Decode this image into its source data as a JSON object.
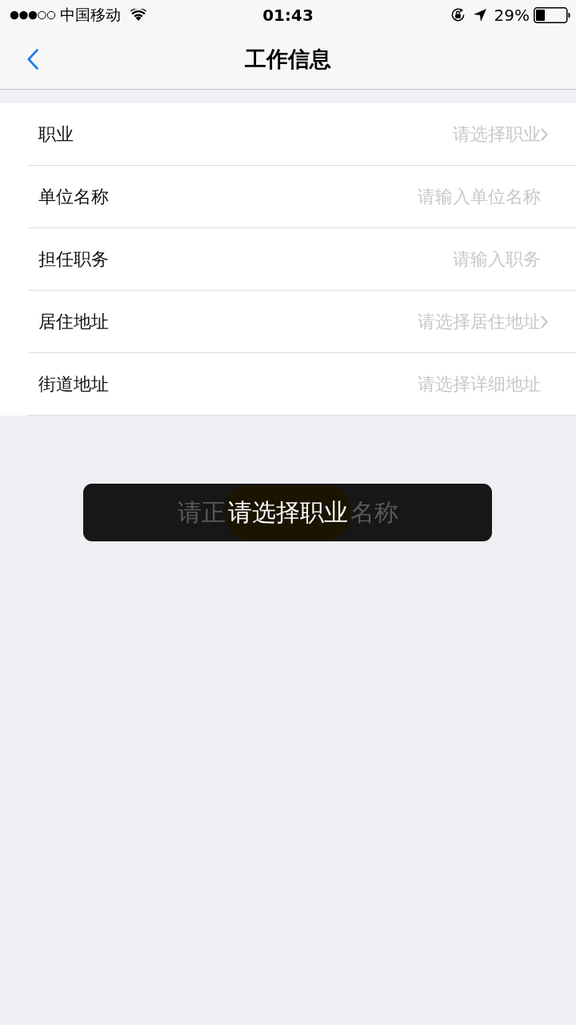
{
  "status_bar": {
    "carrier": "中国移动",
    "time": "01:43",
    "battery": "29%"
  },
  "nav": {
    "title": "工作信息"
  },
  "rows": [
    {
      "label": "职业",
      "placeholder": "请选择职业",
      "kind": "select"
    },
    {
      "label": "单位名称",
      "placeholder": "请输入单位名称",
      "kind": "input"
    },
    {
      "label": "担任职务",
      "placeholder": "请输入职务",
      "kind": "input"
    },
    {
      "label": "居住地址",
      "placeholder": "请选择居住地址",
      "kind": "select"
    },
    {
      "label": "街道地址",
      "placeholder": "请选择详细地址",
      "kind": "input"
    }
  ],
  "toast": {
    "previous_toast_parts": [
      "请正",
      "名称"
    ],
    "message": "请选择职业"
  }
}
